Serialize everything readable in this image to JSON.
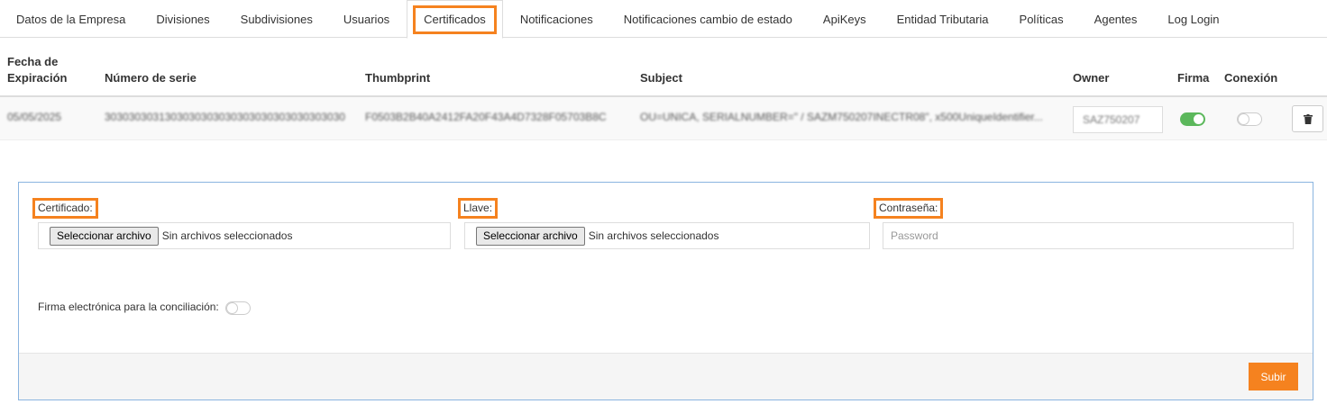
{
  "tabs": [
    {
      "label": "Datos de la Empresa"
    },
    {
      "label": "Divisiones"
    },
    {
      "label": "Subdivisiones"
    },
    {
      "label": "Usuarios"
    },
    {
      "label": "Certificados",
      "active": true
    },
    {
      "label": "Notificaciones"
    },
    {
      "label": "Notificaciones cambio de estado"
    },
    {
      "label": "ApiKeys"
    },
    {
      "label": "Entidad Tributaria"
    },
    {
      "label": "Políticas"
    },
    {
      "label": "Agentes"
    },
    {
      "label": "Log Login"
    }
  ],
  "table": {
    "headers": {
      "expiration_line1": "Fecha de",
      "expiration_line2": "Expiración",
      "serial": "Número de serie",
      "thumbprint": "Thumbprint",
      "subject": "Subject",
      "owner": "Owner",
      "firma": "Firma",
      "conexion": "Conexión"
    },
    "rows": [
      {
        "expiration": "05/05/2025",
        "serial": "3030303031303030303030303030303030303030",
        "thumbprint": "F0503B2B40A2412FA20F43A4D7328F05703B8C",
        "subject": "OU=UNICA, SERIALNUMBER=\" / SAZM750207INECTR08\", x500UniqueIdentifier...",
        "owner": "SAZ750207",
        "firma": true,
        "conexion": false
      }
    ]
  },
  "upload": {
    "certificado_label": "Certificado:",
    "llave_label": "Llave:",
    "password_label": "Contraseña:",
    "file_button": "Seleccionar archivo",
    "file_status": "Sin archivos seleccionados",
    "password_placeholder": "Password",
    "firma_conciliacion_label": "Firma electrónica para la conciliación:",
    "firma_conciliacion_on": false,
    "submit_label": "Subir"
  },
  "colors": {
    "accent": "#f5821f",
    "toggle_on": "#5cb85c",
    "panel_border": "#8ab4e0"
  }
}
